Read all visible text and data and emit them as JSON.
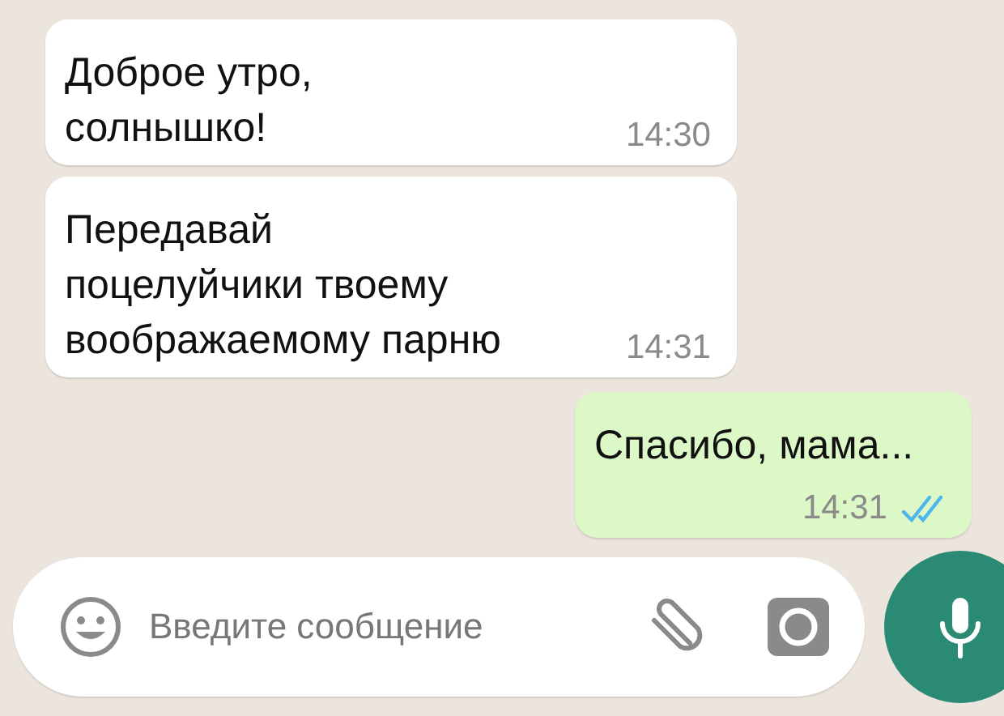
{
  "messages": [
    {
      "kind": "incoming",
      "text": "Доброе утро,\nсолнышко!",
      "time": "14:30"
    },
    {
      "kind": "incoming",
      "text": "Передавай\nпоцелуйчики твоему\nвоображаемому парню",
      "time": "14:31"
    },
    {
      "kind": "outgoing",
      "text": "Спасибо, мама...",
      "time": "14:31",
      "read": true
    }
  ],
  "composer": {
    "placeholder": "Введите сообщение"
  }
}
